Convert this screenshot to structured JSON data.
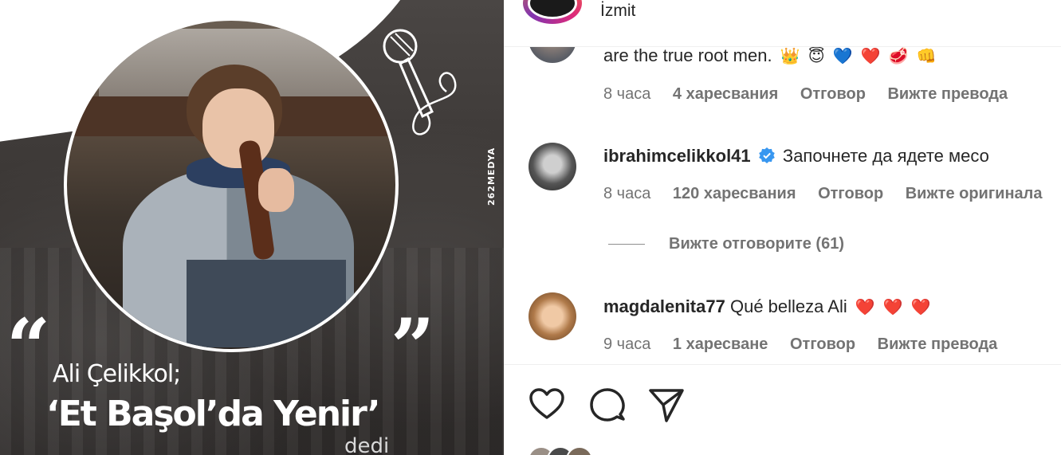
{
  "post_image": {
    "quote_open": "“",
    "quote_close": "”",
    "caption_line1": "Ali Çelikkol;",
    "caption_line2": "‘Et Başol’da Yenir’",
    "caption_line3": "dedi",
    "watermark": "262MEDYA"
  },
  "header": {
    "location": "İzmit"
  },
  "comments": [
    {
      "username": "",
      "text": "are the true root men.",
      "emojis": [
        "👑",
        "😇",
        "💙",
        "❤️",
        "🥩",
        "👊"
      ],
      "time": "8 часа",
      "likes": "4 харесвания",
      "reply": "Отговор",
      "translate": "Вижте превода"
    },
    {
      "username": "ibrahimcelikkol41",
      "verified": true,
      "text": "Започнете да ядете месо",
      "time": "8 часа",
      "likes": "120 харесвания",
      "reply": "Отговор",
      "translate": "Вижте оригинала",
      "view_replies": "Вижте отговорите (61)"
    },
    {
      "username": "magdalenita77",
      "text": "Qué belleza Ali",
      "emojis": [
        "❤️",
        "❤️",
        "❤️"
      ],
      "time": "9 часа",
      "likes": "1 харесване",
      "reply": "Отговор",
      "translate": "Вижте превода"
    }
  ],
  "actions": {
    "like_icon": "heart-icon",
    "comment_icon": "comment-icon",
    "share_icon": "send-icon"
  },
  "colors": {
    "text_primary": "#262626",
    "text_secondary": "#737373",
    "verified": "#3897f0",
    "heart": "#e0245e"
  }
}
